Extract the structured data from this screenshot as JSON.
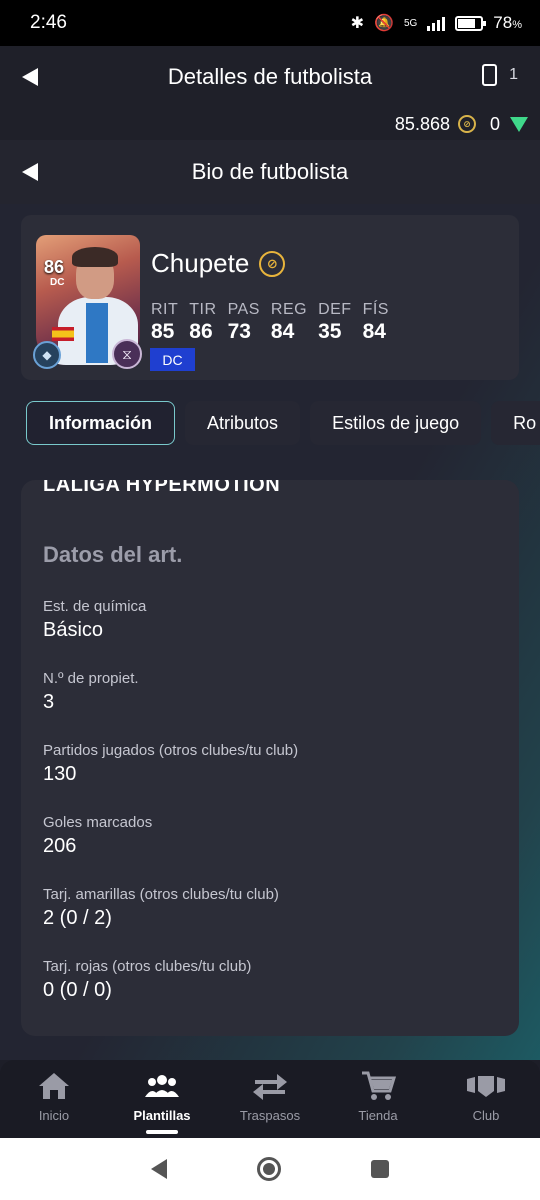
{
  "status_bar": {
    "time": "2:46",
    "network": "5G",
    "battery": "78",
    "battery_unit": "%",
    "battery_level": 0.78
  },
  "header1": {
    "title": "Detalles de futbolista",
    "card_count": "1"
  },
  "currency": {
    "coins": "85.868",
    "points": "0"
  },
  "header2": {
    "title": "Bio de futbolista"
  },
  "player": {
    "name": "Chupete",
    "rating": "86",
    "position_small": "DC",
    "position": "DC",
    "stats": [
      {
        "label": "RIT",
        "value": "85"
      },
      {
        "label": "TIR",
        "value": "86"
      },
      {
        "label": "PAS",
        "value": "73"
      },
      {
        "label": "REG",
        "value": "84"
      },
      {
        "label": "DEF",
        "value": "35"
      },
      {
        "label": "FÍS",
        "value": "84"
      }
    ]
  },
  "tabs": [
    {
      "label": "Información",
      "active": true
    },
    {
      "label": "Atributos"
    },
    {
      "label": "Estilos de juego"
    },
    {
      "label": "Ro"
    }
  ],
  "info": {
    "league": "LALIGA HYPERMOTION",
    "section_title": "Datos del art.",
    "fields": [
      {
        "label": "Est. de química",
        "value": "Básico"
      },
      {
        "label": "N.º de propiet.",
        "value": "3"
      },
      {
        "label": "Partidos jugados (otros clubes/tu club)",
        "value": "130"
      },
      {
        "label": "Goles marcados",
        "value": "206"
      },
      {
        "label": "Tarj. amarillas (otros clubes/tu club)",
        "value": "2 (0 / 2)"
      },
      {
        "label": "Tarj. rojas (otros clubes/tu club)",
        "value": "0 (0 / 0)"
      }
    ]
  },
  "bottom_nav": [
    {
      "label": "Inicio",
      "icon": "home-icon"
    },
    {
      "label": "Plantillas",
      "icon": "squad-icon",
      "active": true
    },
    {
      "label": "Traspasos",
      "icon": "transfer-icon"
    },
    {
      "label": "Tienda",
      "icon": "cart-icon"
    },
    {
      "label": "Club",
      "icon": "club-icon"
    }
  ],
  "colors": {
    "accent_tab_border": "#79c9cc",
    "position_chip": "#1f3fd0",
    "coin": "#d8b34a",
    "points": "#3fd88a"
  }
}
